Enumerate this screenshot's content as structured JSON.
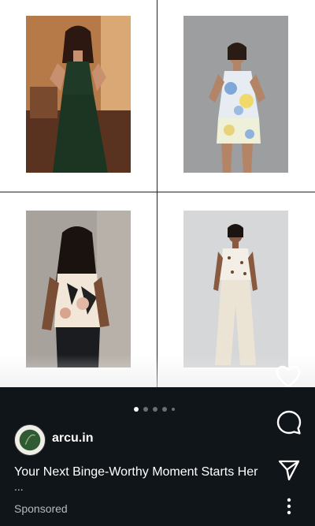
{
  "post": {
    "handle": "arcu.in",
    "caption": "Your Next Binge-Worthy Moment Starts Her",
    "caption_more": "...",
    "sponsored_label": "Sponsored"
  },
  "carousel": {
    "total_dots": 5,
    "active_index": 0
  },
  "products": [
    {
      "name": "product-dark-green-cutout-dress"
    },
    {
      "name": "product-pastel-print-coord-set"
    },
    {
      "name": "product-floral-halter-top"
    },
    {
      "name": "product-cream-top-trousers"
    }
  ],
  "icons": {
    "like": "heart-icon",
    "comment": "comment-icon",
    "share": "send-icon",
    "more": "more-vertical-icon"
  },
  "colors": {
    "panel_bg": "#10151a",
    "text_primary": "#ffffff",
    "text_secondary": "#b6bbc0",
    "grid_line": "#222222"
  }
}
